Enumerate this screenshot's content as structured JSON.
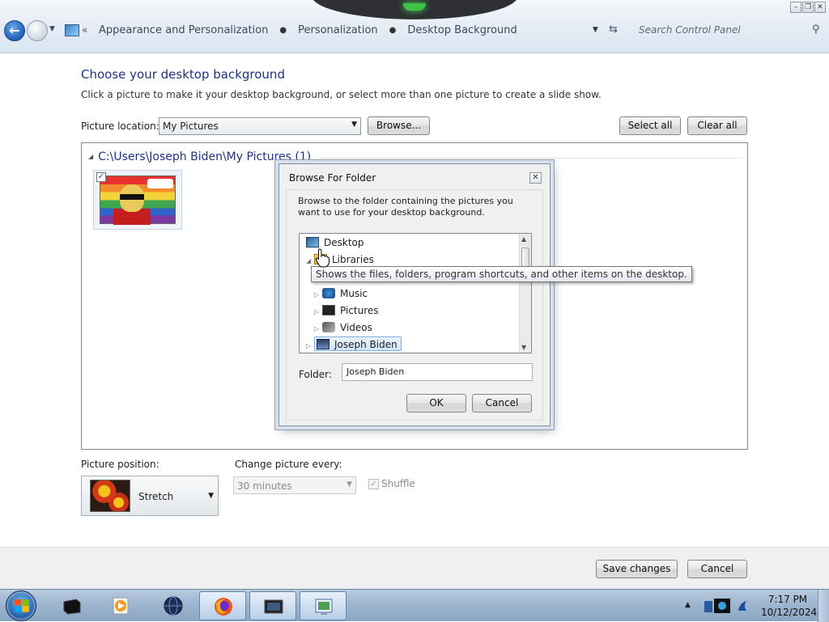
{
  "window": {
    "minimize_glyph": "–",
    "maximize_glyph": "❐",
    "close_glyph": "✕"
  },
  "addressbar": {
    "back_glyph": "←",
    "chevron": "«",
    "breadcrumbs": [
      "Appearance and Personalization",
      "Personalization",
      "Desktop Background"
    ],
    "separator": "▸",
    "search_placeholder": "Search Control Panel"
  },
  "main": {
    "title": "Choose your desktop background",
    "instruction": "Click a picture to make it your desktop background, or select more than one picture to create a slide show.",
    "location_label": "Picture location:",
    "location_value": "My Pictures",
    "browse_label": "Browse...",
    "select_all_label": "Select all",
    "clear_all_label": "Clear all",
    "group_header": "C:\\Users\\Joseph Biden\\My Pictures (1)",
    "thumbnail_checked": "✓"
  },
  "dialog": {
    "title": "Browse For Folder",
    "close_glyph": "✕",
    "instruction": "Browse to the folder containing the pictures you want to use for your desktop background.",
    "tree": [
      {
        "label": "Desktop",
        "icon": "desktop-icon",
        "expander": ""
      },
      {
        "label": "Libraries",
        "icon": "libraries-icon",
        "expander": "◢"
      },
      {
        "label": "Music",
        "icon": "music-icon",
        "expander": "▷"
      },
      {
        "label": "Pictures",
        "icon": "pictures-icon",
        "expander": "▷"
      },
      {
        "label": "Videos",
        "icon": "videos-icon",
        "expander": "▷"
      },
      {
        "label": "Joseph Biden",
        "icon": "user-folder-icon",
        "expander": "▷",
        "selected": true
      }
    ],
    "tooltip": "Shows the files, folders, program shortcuts, and other items on the desktop.",
    "folder_label": "Folder:",
    "folder_value": "Joseph Biden",
    "ok_label": "OK",
    "cancel_label": "Cancel"
  },
  "lower": {
    "position_label": "Picture position:",
    "position_value": "Stretch",
    "change_label": "Change picture every:",
    "change_value": "30 minutes",
    "shuffle_label": "Shuffle",
    "shuffle_checked": "✓"
  },
  "footer": {
    "save_label": "Save changes",
    "cancel_label": "Cancel"
  },
  "taskbar": {
    "time": "7:17 PM",
    "date": "10/12/2024"
  },
  "colors": {
    "title_blue": "#1e3287",
    "taskbar": "#9eb6cf",
    "selection": "#cfe6fb"
  }
}
